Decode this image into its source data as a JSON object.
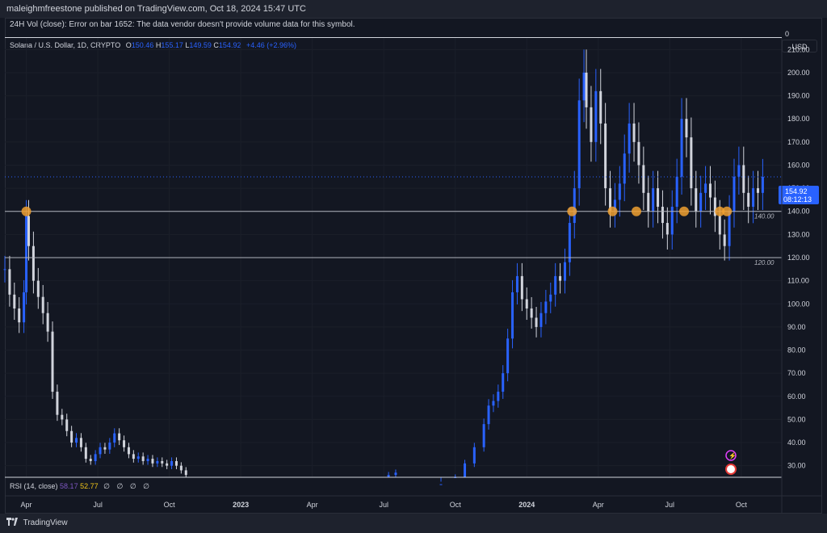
{
  "header": {
    "published": "maleighmfreestone published on TradingView.com, Oct 18, 2024 15:47 UTC"
  },
  "volume_pane": {
    "message": "24H Vol (close): Error on bar 1652: The data vendor doesn't provide volume data for this symbol.",
    "scale_value": "0"
  },
  "legend": {
    "symbol": "Solana / U.S. Dollar, 1D, CRYPTO",
    "o_label": "O",
    "o_value": "150.46",
    "h_label": "H",
    "h_value": "155.17",
    "l_label": "L",
    "l_value": "149.59",
    "c_label": "C",
    "c_value": "154.92",
    "change": "+4.46 (+2.96%)"
  },
  "currency": "USD",
  "price_tag": {
    "price": "154.92",
    "countdown": "08:12:13"
  },
  "rsi": {
    "label": "RSI (14, close)",
    "v1": "58.17",
    "v2": "52.77",
    "icons": "∅ ∅ ∅ ∅"
  },
  "footer": {
    "brand": "TradingView"
  },
  "colors": {
    "up": "#2962ff",
    "down": "#d1d4dc",
    "marker": "#f0a030",
    "line": "#b2b5be",
    "accent": "#2962ff"
  },
  "chart_data": {
    "type": "candlestick",
    "title": "Solana / U.S. Dollar, 1D, CRYPTO",
    "ylim": [
      25,
      215
    ],
    "y_ticks": [
      30,
      40,
      50,
      60,
      70,
      80,
      90,
      100,
      110,
      120,
      130,
      140,
      150,
      160,
      170,
      180,
      190,
      200,
      210
    ],
    "x_ticks": [
      "Apr",
      "Jul",
      "Oct",
      "2023",
      "Apr",
      "Jul",
      "Oct",
      "2024",
      "Apr",
      "Jul",
      "Oct"
    ],
    "x_tick_months": [
      3,
      6,
      9,
      12,
      15,
      18,
      21,
      24,
      27,
      30,
      33
    ],
    "x_range_months": [
      2.1,
      34.7
    ],
    "horizontal_levels": [
      {
        "value": 140,
        "label": "140.00"
      },
      {
        "value": 120,
        "label": "120.00"
      }
    ],
    "markers": {
      "value": 140,
      "months": [
        3.0,
        25.9,
        27.6,
        28.6,
        30.6,
        32.1,
        32.4
      ]
    },
    "close_series": [
      [
        2.1,
        115
      ],
      [
        2.3,
        104
      ],
      [
        2.5,
        98
      ],
      [
        2.7,
        92
      ],
      [
        2.9,
        105
      ],
      [
        3.0,
        138
      ],
      [
        3.1,
        125
      ],
      [
        3.3,
        110
      ],
      [
        3.5,
        103
      ],
      [
        3.7,
        96
      ],
      [
        3.9,
        88
      ],
      [
        4.1,
        62
      ],
      [
        4.3,
        52
      ],
      [
        4.5,
        50
      ],
      [
        4.7,
        45
      ],
      [
        4.9,
        40
      ],
      [
        5.1,
        42
      ],
      [
        5.3,
        38
      ],
      [
        5.5,
        33
      ],
      [
        5.7,
        32
      ],
      [
        5.9,
        35
      ],
      [
        6.1,
        38
      ],
      [
        6.3,
        37
      ],
      [
        6.5,
        40
      ],
      [
        6.7,
        44
      ],
      [
        6.9,
        41
      ],
      [
        7.1,
        38
      ],
      [
        7.3,
        35
      ],
      [
        7.5,
        33
      ],
      [
        7.7,
        34
      ],
      [
        7.9,
        32
      ],
      [
        8.1,
        33
      ],
      [
        8.3,
        31
      ],
      [
        8.5,
        32
      ],
      [
        8.7,
        31
      ],
      [
        8.9,
        30
      ],
      [
        9.1,
        32
      ],
      [
        9.3,
        30
      ],
      [
        9.5,
        28
      ],
      [
        9.7,
        26
      ],
      [
        18.2,
        26
      ],
      [
        18.5,
        27
      ],
      [
        20.4,
        22
      ],
      [
        21.0,
        25
      ],
      [
        21.4,
        31
      ],
      [
        21.8,
        38
      ],
      [
        22.2,
        48
      ],
      [
        22.4,
        56
      ],
      [
        22.6,
        58
      ],
      [
        22.8,
        62
      ],
      [
        23.0,
        70
      ],
      [
        23.2,
        85
      ],
      [
        23.4,
        105
      ],
      [
        23.6,
        112
      ],
      [
        23.8,
        102
      ],
      [
        24.0,
        98
      ],
      [
        24.2,
        94
      ],
      [
        24.4,
        90
      ],
      [
        24.6,
        96
      ],
      [
        24.8,
        101
      ],
      [
        25.0,
        104
      ],
      [
        25.2,
        112
      ],
      [
        25.4,
        110
      ],
      [
        25.6,
        118
      ],
      [
        25.8,
        135
      ],
      [
        26.0,
        150
      ],
      [
        26.2,
        188
      ],
      [
        26.4,
        200
      ],
      [
        26.5,
        185
      ],
      [
        26.7,
        170
      ],
      [
        26.9,
        192
      ],
      [
        27.1,
        178
      ],
      [
        27.3,
        150
      ],
      [
        27.5,
        140
      ],
      [
        27.7,
        145
      ],
      [
        27.9,
        152
      ],
      [
        28.1,
        165
      ],
      [
        28.3,
        178
      ],
      [
        28.5,
        170
      ],
      [
        28.7,
        160
      ],
      [
        28.9,
        148
      ],
      [
        29.1,
        140
      ],
      [
        29.3,
        150
      ],
      [
        29.5,
        142
      ],
      [
        29.7,
        135
      ],
      [
        29.9,
        130
      ],
      [
        30.1,
        142
      ],
      [
        30.3,
        155
      ],
      [
        30.5,
        180
      ],
      [
        30.7,
        172
      ],
      [
        30.9,
        150
      ],
      [
        31.1,
        140
      ],
      [
        31.3,
        148
      ],
      [
        31.5,
        152
      ],
      [
        31.7,
        146
      ],
      [
        31.9,
        138
      ],
      [
        32.1,
        130
      ],
      [
        32.3,
        125
      ],
      [
        32.5,
        140
      ],
      [
        32.7,
        155
      ],
      [
        32.9,
        160
      ],
      [
        33.1,
        148
      ],
      [
        33.3,
        142
      ],
      [
        33.5,
        150
      ],
      [
        33.7,
        148
      ],
      [
        33.9,
        154.92
      ]
    ]
  }
}
